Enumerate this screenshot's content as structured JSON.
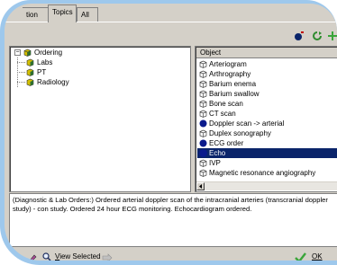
{
  "tabs": [
    {
      "label": "tion",
      "active": false
    },
    {
      "label": "Topics",
      "active": true
    },
    {
      "label": "All",
      "active": false
    }
  ],
  "toolbar": {
    "icons": [
      "blue-ball-flag-icon",
      "refresh-icon",
      "add-icon"
    ],
    "colors": {
      "accent": "#0a246a",
      "frame": "#9ec8ec",
      "face": "#d4d0c8"
    }
  },
  "tree": {
    "root": {
      "label": "Ordering",
      "icon": "cube-icon",
      "expanded": true
    },
    "children": [
      {
        "label": "Labs",
        "icon": "cube-icon"
      },
      {
        "label": "PT",
        "icon": "cube-icon"
      },
      {
        "label": "Radiology",
        "icon": "cube-icon"
      }
    ]
  },
  "objects": {
    "header": "Object",
    "items": [
      {
        "label": "Arteriogram",
        "icon": "cube-outline-icon",
        "selected": false
      },
      {
        "label": "Arthrography",
        "icon": "cube-outline-icon",
        "selected": false
      },
      {
        "label": "Barium enema",
        "icon": "cube-outline-icon",
        "selected": false
      },
      {
        "label": "Barium swallow",
        "icon": "cube-outline-icon",
        "selected": false
      },
      {
        "label": "Bone scan",
        "icon": "cube-outline-icon",
        "selected": false
      },
      {
        "label": "CT scan",
        "icon": "cube-outline-icon",
        "selected": false
      },
      {
        "label": "Doppler scan -> arterial",
        "icon": "blue-dot-icon",
        "selected": false
      },
      {
        "label": "Duplex sonography",
        "icon": "cube-outline-icon",
        "selected": false
      },
      {
        "label": "ECG order",
        "icon": "blue-dot-icon",
        "selected": false
      },
      {
        "label": "Echo",
        "icon": "blue-dot-icon",
        "selected": true
      },
      {
        "label": "IVP",
        "icon": "cube-outline-icon",
        "selected": false
      },
      {
        "label": "Magnetic resonance angiography",
        "icon": "cube-outline-icon",
        "selected": false
      }
    ]
  },
  "notes": {
    "text": "(Diagnostic & Lab Orders:) Ordered arterial doppler scan of the intracranial arteries (transcranial doppler study) - con study. Ordered 24 hour ECG monitoring. Echocardiogram ordered."
  },
  "bottom": {
    "view_selected_label": "View Selected",
    "ok_label": "OK"
  }
}
